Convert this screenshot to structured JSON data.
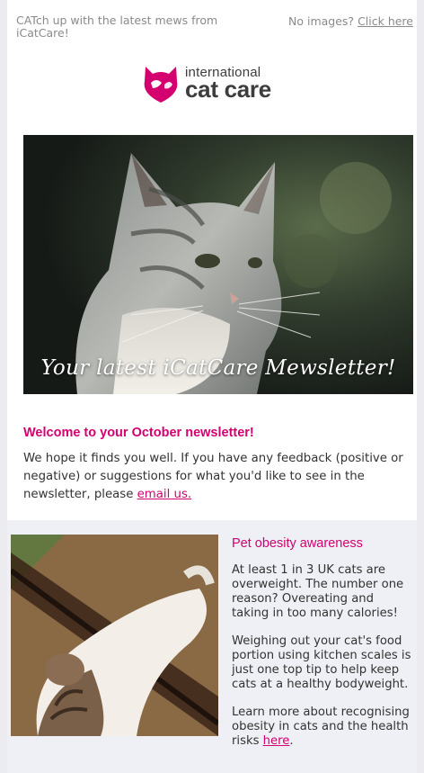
{
  "preheader": {
    "text": "CATch up with the latest mews from iCatCare!",
    "no_images_text": "No images?",
    "click_here_label": "Click here"
  },
  "logo": {
    "line1": "international",
    "line2": "cat care"
  },
  "hero": {
    "title": "Your latest iCatCare Mewsletter!"
  },
  "welcome": {
    "heading": "Welcome to your October newsletter!",
    "body": "We hope it finds you well. If you have any feedback (positive or negative) or suggestions for what you'd like to see in the newsletter, please",
    "link_label": "email us."
  },
  "obesity": {
    "title": "Pet obesity awareness",
    "p1": "At least 1 in 3 UK cats are overweight. The number one reason? Overeating and taking in too many calories!",
    "p2": "Weighing out your cat's food portion using kitchen scales is just one top tip to help keep cats at a healthy bodyweight.",
    "p3": "Learn more about recognising obesity in cats and the health risks",
    "link_label": "here"
  },
  "colors": {
    "brand_pink": "#d4006f",
    "text": "#333333",
    "muted": "#8a8a8a"
  }
}
